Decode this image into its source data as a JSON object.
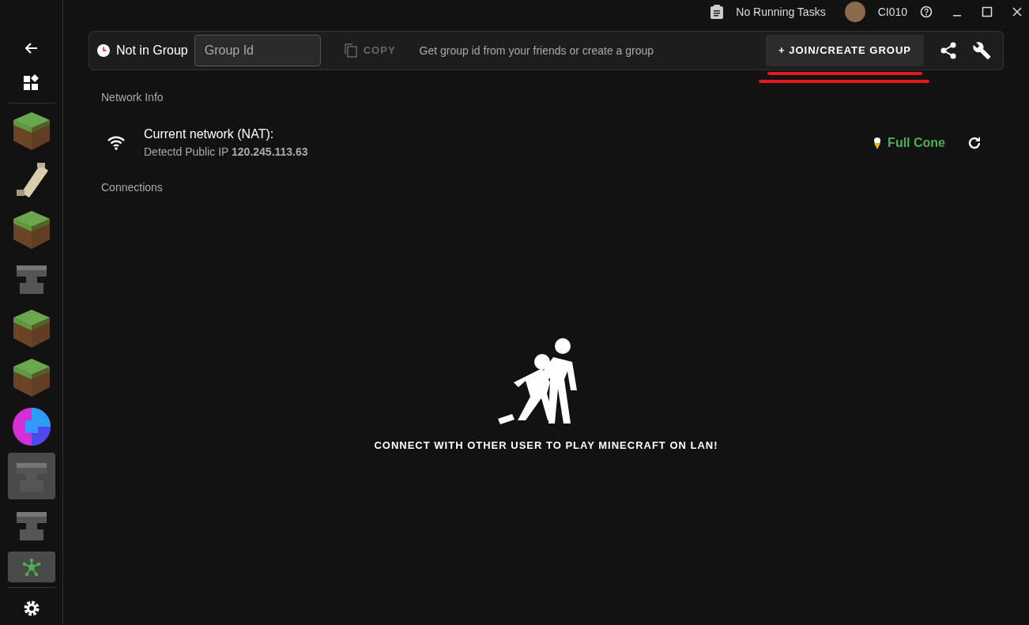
{
  "title_bar": {
    "tasks": "No Running Tasks",
    "user": "CI010"
  },
  "sidebar": {
    "items": [
      {
        "kind": "back",
        "selected": false
      },
      {
        "kind": "apps",
        "selected": false
      },
      {
        "kind": "grass",
        "selected": false
      },
      {
        "kind": "scroll",
        "selected": false
      },
      {
        "kind": "grass",
        "selected": false
      },
      {
        "kind": "anvil",
        "selected": false
      },
      {
        "kind": "grass",
        "selected": false
      },
      {
        "kind": "grass",
        "selected": false
      },
      {
        "kind": "quilt",
        "selected": false
      },
      {
        "kind": "anvil",
        "selected": true
      },
      {
        "kind": "anvil",
        "selected": false
      },
      {
        "kind": "network",
        "selected": true
      },
      {
        "kind": "settings",
        "selected": false
      }
    ]
  },
  "toolbar": {
    "status": "Not in Group",
    "group_id": {
      "placeholder": "Group Id"
    },
    "copy": {
      "label": "COPY",
      "disabled": true
    },
    "hint": "Get group id from your friends or create a group",
    "join": {
      "label": "+ JOIN/CREATE GROUP",
      "underlined": true
    }
  },
  "network_info": {
    "heading": "Network Info",
    "title": "Current network (NAT):",
    "detail": "Detectd Public IP **120.245.113.63**",
    "nat_type": "Full Cone"
  },
  "connections": {
    "heading": "Connections",
    "empty_message": "CONNECT WITH OTHER USER TO PLAY MINECRAFT ON LAN!"
  }
}
